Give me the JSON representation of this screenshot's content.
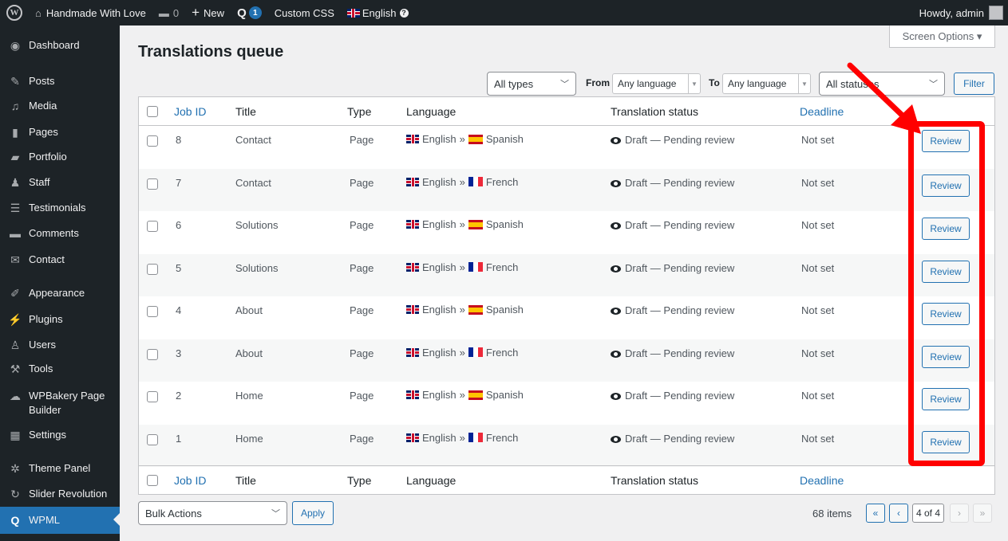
{
  "adminbar": {
    "site_name": "Handmade With Love",
    "comments_count": "0",
    "new_label": "New",
    "wpml_badge": "1",
    "custom_css": "Custom CSS",
    "language": "English",
    "greeting": "Howdy, admin"
  },
  "sidebar": {
    "items": [
      {
        "label": "Dashboard",
        "icon": "dashboard-icon"
      },
      {
        "label": "Posts",
        "icon": "pin-icon"
      },
      {
        "label": "Media",
        "icon": "media-icon"
      },
      {
        "label": "Pages",
        "icon": "page-icon"
      },
      {
        "label": "Portfolio",
        "icon": "folder-icon"
      },
      {
        "label": "Staff",
        "icon": "staff-icon"
      },
      {
        "label": "Testimonials",
        "icon": "testimonial-icon"
      },
      {
        "label": "Comments",
        "icon": "comment-icon"
      },
      {
        "label": "Contact",
        "icon": "mail-icon"
      },
      {
        "label": "Appearance",
        "icon": "brush-icon"
      },
      {
        "label": "Plugins",
        "icon": "plugin-icon"
      },
      {
        "label": "Users",
        "icon": "user-icon"
      },
      {
        "label": "Tools",
        "icon": "wrench-icon"
      },
      {
        "label": "WPBakery Page",
        "label2": "Builder",
        "icon": "wpbakery-icon"
      },
      {
        "label": "Settings",
        "icon": "settings-icon"
      },
      {
        "label": "Theme Panel",
        "icon": "gear-icon"
      },
      {
        "label": "Slider Revolution",
        "icon": "refresh-icon"
      },
      {
        "label": "WPML",
        "icon": "wpml-icon"
      }
    ]
  },
  "page": {
    "title": "Translations queue",
    "screen_options": "Screen Options ▾"
  },
  "filters": {
    "type_value": "All types",
    "from_label": "From",
    "from_value": "Any language",
    "to_label": "To",
    "to_value": "Any language",
    "status_value": "All statuses",
    "filter_button": "Filter"
  },
  "table": {
    "headers": {
      "job_id": "Job ID",
      "title": "Title",
      "type": "Type",
      "language": "Language",
      "status": "Translation status",
      "deadline": "Deadline"
    },
    "rows": [
      {
        "id": "8",
        "title": "Contact",
        "type": "Page",
        "from": "English",
        "to": "Spanish",
        "status": "Draft — Pending review",
        "deadline": "Not set",
        "action": "Review"
      },
      {
        "id": "7",
        "title": "Contact",
        "type": "Page",
        "from": "English",
        "to": "French",
        "status": "Draft — Pending review",
        "deadline": "Not set",
        "action": "Review"
      },
      {
        "id": "6",
        "title": "Solutions",
        "type": "Page",
        "from": "English",
        "to": "Spanish",
        "status": "Draft — Pending review",
        "deadline": "Not set",
        "action": "Review"
      },
      {
        "id": "5",
        "title": "Solutions",
        "type": "Page",
        "from": "English",
        "to": "French",
        "status": "Draft — Pending review",
        "deadline": "Not set",
        "action": "Review"
      },
      {
        "id": "4",
        "title": "About",
        "type": "Page",
        "from": "English",
        "to": "Spanish",
        "status": "Draft — Pending review",
        "deadline": "Not set",
        "action": "Review"
      },
      {
        "id": "3",
        "title": "About",
        "type": "Page",
        "from": "English",
        "to": "French",
        "status": "Draft — Pending review",
        "deadline": "Not set",
        "action": "Review"
      },
      {
        "id": "2",
        "title": "Home",
        "type": "Page",
        "from": "English",
        "to": "Spanish",
        "status": "Draft — Pending review",
        "deadline": "Not set",
        "action": "Review"
      },
      {
        "id": "1",
        "title": "Home",
        "type": "Page",
        "from": "English",
        "to": "French",
        "status": "Draft — Pending review",
        "deadline": "Not set",
        "action": "Review"
      }
    ]
  },
  "bulk": {
    "actions_value": "Bulk Actions",
    "apply_button": "Apply"
  },
  "pagination": {
    "items": "68 items",
    "first": "«",
    "prev": "‹",
    "current": "4 of 4",
    "next": "›",
    "last": "»"
  },
  "colors": {
    "annotation": "#ff0000",
    "accent": "#2271b1",
    "sidebar_bg": "#1d2327"
  }
}
